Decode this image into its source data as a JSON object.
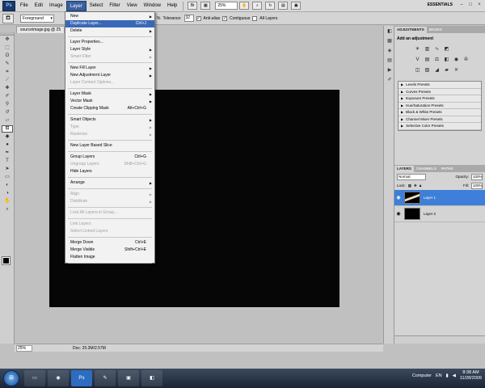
{
  "app": {
    "logo": "Ps",
    "menu": [
      "File",
      "Edit",
      "Image",
      "Layer",
      "Select",
      "Filter",
      "View",
      "Window",
      "Help"
    ],
    "active_menu": "Layer",
    "zoom": "25%",
    "workspace": "ESSENTIALS",
    "window_buttons": [
      "–",
      "□",
      "×"
    ]
  },
  "options_bar": {
    "tool_icon": "paint-bucket-icon",
    "fill_source": "Foreground",
    "opacity_partial": "%",
    "tolerance_label": "Tolerance:",
    "tolerance_value": "32",
    "antialias_label": "Anti-alias",
    "contiguous_label": "Contiguous",
    "all_layers_label": "All Layers"
  },
  "document": {
    "tab_label": "sourceimage.jpg @ 25",
    "zoom": "25%",
    "doc_info": "Doc: 20.3M/2.57M",
    "canvas_color": "#060606"
  },
  "layer_menu": [
    {
      "label": "New",
      "arrow": true
    },
    {
      "label": "Duplicate Layer...",
      "shortcut": "Ctrl+J",
      "highlight": true
    },
    {
      "label": "Delete",
      "arrow": true
    },
    {
      "sep": true
    },
    {
      "label": "Layer Properties..."
    },
    {
      "label": "Layer Style",
      "arrow": true
    },
    {
      "label": "Smart Filter",
      "arrow": true,
      "disabled": true
    },
    {
      "sep": true
    },
    {
      "label": "New Fill Layer",
      "arrow": true
    },
    {
      "label": "New Adjustment Layer",
      "arrow": true
    },
    {
      "label": "Layer Content Options...",
      "disabled": true
    },
    {
      "sep": true
    },
    {
      "label": "Layer Mask",
      "arrow": true
    },
    {
      "label": "Vector Mask",
      "arrow": true
    },
    {
      "label": "Create Clipping Mask",
      "shortcut": "Alt+Ctrl+G"
    },
    {
      "sep": true
    },
    {
      "label": "Smart Objects",
      "arrow": true
    },
    {
      "label": "Type",
      "arrow": true,
      "disabled": true
    },
    {
      "label": "Rasterize",
      "arrow": true,
      "disabled": true
    },
    {
      "sep": true
    },
    {
      "label": "New Layer Based Slice"
    },
    {
      "sep": true
    },
    {
      "label": "Group Layers",
      "shortcut": "Ctrl+G"
    },
    {
      "label": "Ungroup Layers",
      "shortcut": "Shift+Ctrl+G",
      "disabled": true
    },
    {
      "label": "Hide Layers"
    },
    {
      "sep": true
    },
    {
      "label": "Arrange",
      "arrow": true
    },
    {
      "sep": true
    },
    {
      "label": "Align",
      "arrow": true,
      "disabled": true
    },
    {
      "label": "Distribute",
      "arrow": true,
      "disabled": true
    },
    {
      "sep": true
    },
    {
      "label": "Lock All Layers in Group...",
      "disabled": true
    },
    {
      "sep": true
    },
    {
      "label": "Link Layers",
      "disabled": true
    },
    {
      "label": "Select Linked Layers",
      "disabled": true
    },
    {
      "sep": true
    },
    {
      "label": "Merge Down",
      "shortcut": "Ctrl+E"
    },
    {
      "label": "Merge Visible",
      "shortcut": "Shift+Ctrl+E"
    },
    {
      "label": "Flatten Image"
    },
    {
      "sep": true
    },
    {
      "label": "Matting",
      "arrow": true
    }
  ],
  "adjustments": {
    "tabs": [
      "ADJUSTMENTS",
      "MASKS"
    ],
    "title": "Add an adjustment",
    "presets": [
      "Levels Presets",
      "Curves Presets",
      "Exposure Presets",
      "Hue/Saturation Presets",
      "Black & White Presets",
      "Channel Mixer Presets",
      "Selective Color Presets"
    ]
  },
  "layers": {
    "tabs": [
      "LAYERS",
      "CHANNELS",
      "PATHS"
    ],
    "blend_mode": "Normal",
    "opacity_label": "Opacity:",
    "opacity": "100%",
    "lock_label": "Lock:",
    "fill_label": "Fill:",
    "fill": "100%",
    "items": [
      {
        "name": "Layer 1",
        "selected": true
      },
      {
        "name": "Layer 2",
        "selected": false
      }
    ]
  },
  "taskbar": {
    "computer_label": "Computer",
    "lang": "EN",
    "time": "8:38 AM",
    "date": "11/28/2009"
  }
}
